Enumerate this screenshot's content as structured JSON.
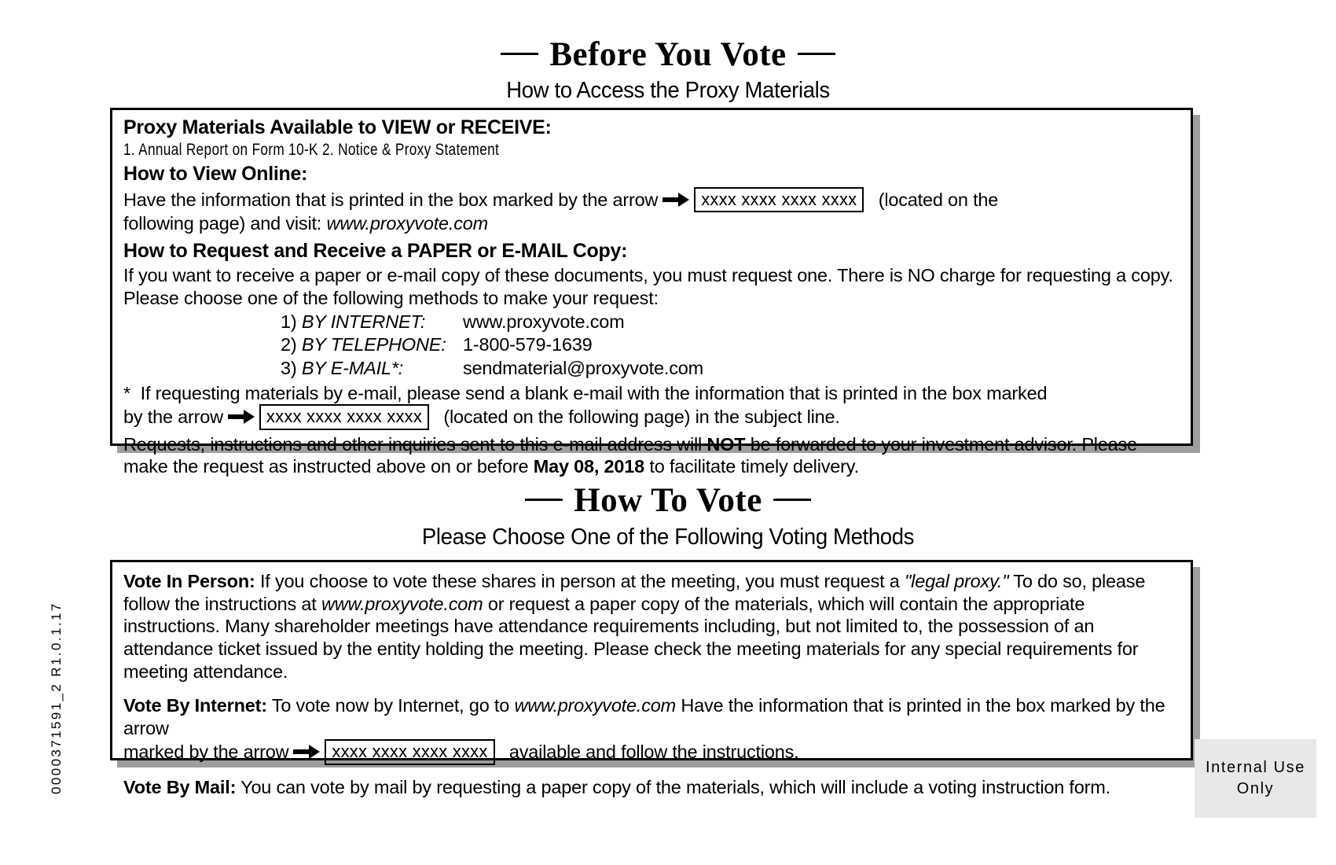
{
  "document": {
    "side_code": "0000371591_2    R1.0.1.17",
    "internal_use": {
      "line1": "Internal Use",
      "line2": "Only"
    }
  },
  "before_you_vote": {
    "title": "Before You Vote",
    "subtitle": "How to Access the Proxy Materials",
    "available_heading": "Proxy Materials Available to VIEW or RECEIVE:",
    "available_items": "1. Annual Report on Form 10-K      2. Notice & Proxy Statement",
    "view_online_heading": "How to View Online:",
    "view_online_text_1": "Have the information that is printed in the box marked by the arrow",
    "view_online_code": "xxxx xxxx xxxx xxxx",
    "view_online_text_2": "(located on the",
    "view_online_text_3": "following page) and visit:",
    "view_online_site": "www.proxyvote.com",
    "request_heading": "How to Request and Receive a PAPER or E-MAIL Copy:",
    "request_text": "If you want to receive a paper or e-mail copy of these documents, you must request one.  There is NO charge for requesting a copy.  Please choose one of the following methods to make your request:",
    "methods": [
      {
        "num": "1)",
        "label": "BY INTERNET:",
        "value": "www.proxyvote.com"
      },
      {
        "num": "2)",
        "label": "BY TELEPHONE:",
        "value": "1-800-579-1639"
      },
      {
        "num": "3)",
        "label": "BY E-MAIL*:",
        "value": "sendmaterial@proxyvote.com"
      }
    ],
    "footnote_marker": "*",
    "footnote_text_1": "If requesting materials by e-mail, please send a blank e-mail with the information that is printed in the box marked",
    "footnote_text_2": "by the arrow",
    "footnote_code": "xxxx xxxx xxxx xxxx",
    "footnote_text_3": "(located on the following page) in the subject line.",
    "closing_text_1": "Requests, instructions and other inquiries sent to this e-mail address will",
    "closing_not": "NOT",
    "closing_text_2": "be forwarded to your investment advisor. Please make the request as instructed above on or before",
    "closing_date": "May 08, 2018",
    "closing_text_3": "to facilitate timely delivery."
  },
  "how_to_vote": {
    "title": "How To Vote",
    "subtitle": "Please Choose One of the Following Voting Methods",
    "in_person": {
      "label": "Vote In Person:",
      "text_1": "If you choose to vote these shares in person at the meeting, you must request a",
      "legal_proxy": "\"legal proxy.\"",
      "text_2": "To do so, please follow the instructions at",
      "site": "www.proxyvote.com",
      "text_3": "or request a paper copy of the materials, which will contain the appropriate instructions.  Many shareholder meetings have attendance requirements including, but not limited to, the possession of an attendance ticket issued by the entity holding the meeting.  Please check the meeting materials for any special requirements for meeting attendance."
    },
    "by_internet": {
      "label": "Vote By Internet:",
      "text_1": "To vote now by Internet, go to",
      "site": "www.proxyvote.com",
      "text_2": "Have the information that is printed in the box marked by the arrow",
      "code": "xxxx xxxx xxxx xxxx",
      "text_3": "available and follow the instructions."
    },
    "by_mail": {
      "label": "Vote By Mail:",
      "text": "You can vote by mail by requesting a paper copy of the materials, which will include a voting instruction form."
    }
  }
}
